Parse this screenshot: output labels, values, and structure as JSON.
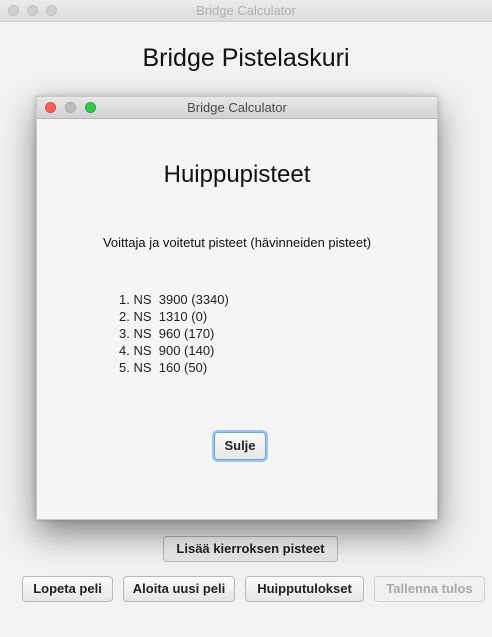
{
  "main_window": {
    "title": "Bridge Calculator",
    "app_title": "Bridge Pistelaskuri",
    "buttons": {
      "add_round": "Lisää kierroksen pisteet",
      "quit": "Lopeta peli",
      "new_game": "Aloita uusi peli",
      "top_results": "Huipputulokset",
      "save_result": "Tallenna tulos"
    }
  },
  "dialog": {
    "title": "Bridge Calculator",
    "heading": "Huippupisteet",
    "subtitle": "Voittaja ja voitetut pisteet (hävinneiden pisteet)",
    "scores": [
      "1. NS  3900 (3340)",
      "2. NS  1310 (0)",
      "3. NS  960 (170)",
      "4. NS  900 (140)",
      "5. NS  160 (50)"
    ],
    "close_label": "Sulje"
  }
}
